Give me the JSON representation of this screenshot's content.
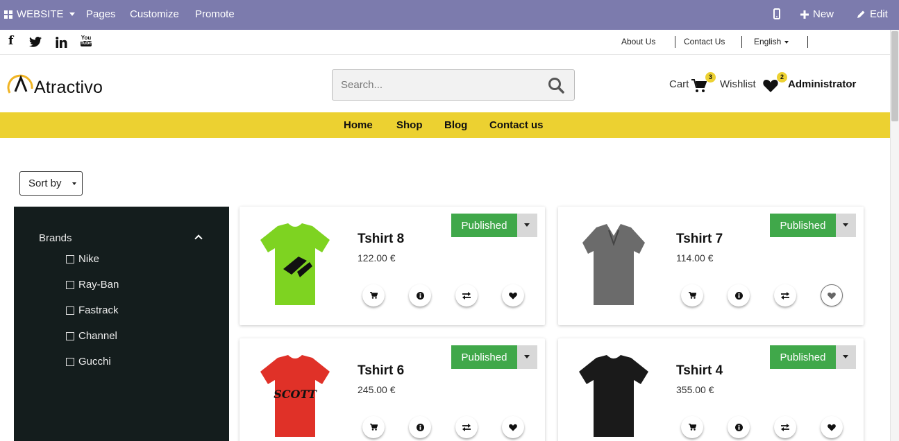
{
  "topbar": {
    "website_label": "WEBSITE",
    "pages": "Pages",
    "customize": "Customize",
    "promote": "Promote",
    "new": "New",
    "edit": "Edit"
  },
  "social": {
    "facebook": "f",
    "youtube_line1": "You",
    "youtube_line2": "Tube"
  },
  "toplinks": {
    "about": "About Us",
    "contact": "Contact Us",
    "language": "English"
  },
  "header": {
    "logo_text": "Atractivo",
    "search_placeholder": "Search...",
    "cart_label": "Cart",
    "cart_count": "3",
    "wishlist_label": "Wishlist",
    "wishlist_count": "2",
    "user": "Administrator"
  },
  "nav": {
    "items": [
      "Home",
      "Shop",
      "Blog",
      "Contact us"
    ]
  },
  "sort": {
    "label": "Sort by"
  },
  "filters": {
    "title": "Brands",
    "brands": [
      "Nike",
      "Ray-Ban",
      "Fastrack",
      "Channel",
      "Gucchi"
    ]
  },
  "products": [
    {
      "name": "Tshirt 8",
      "price": "122.00 €",
      "status": "Published",
      "shirt_color": "#7ed321"
    },
    {
      "name": "Tshirt 7",
      "price": "114.00 €",
      "status": "Published",
      "shirt_color": "#6b6b6b"
    },
    {
      "name": "Tshirt 6",
      "price": "245.00 €",
      "status": "Published",
      "shirt_color": "#e03128"
    },
    {
      "name": "Tshirt 4",
      "price": "355.00 €",
      "status": "Published",
      "shirt_color": "#1a1a1a"
    }
  ],
  "colors": {
    "topbar": "#7c7bad",
    "accent": "#ecd131",
    "published": "#40a84a",
    "sidebar": "#141d1d"
  }
}
